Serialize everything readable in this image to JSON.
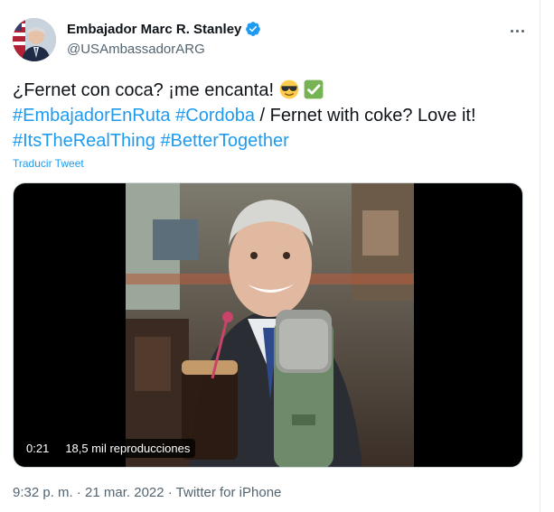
{
  "author": {
    "name": "Embajador Marc R. Stanley",
    "handle": "@USAmbassadorARG",
    "verified": true,
    "avatar_icon": "profile-photo-with-flag"
  },
  "tweet": {
    "line1_text": "¿Fernet con coca? ¡me encanta! ",
    "line1_emojis": [
      "smiling-face-with-sunglasses",
      "check-mark-button"
    ],
    "hashtag1": "#EmbajadorEnRuta",
    "hashtag2": "#Cordoba",
    "text_mid": " / Fernet with coke? Love it! ",
    "hashtag3": "#ItsTheRealThing",
    "hashtag4": "#BetterTogether",
    "translate_label": "Traducir Tweet"
  },
  "video": {
    "duration": "0:21",
    "views": "18,5 mil reproducciones"
  },
  "footer": {
    "time": "9:32 p. m.",
    "separator": " · ",
    "date": "21 mar. 2022",
    "source": "Twitter for iPhone"
  },
  "colors": {
    "link": "#1d9bf0",
    "secondary_text": "#536471",
    "verified_badge": "#1d9bf0"
  }
}
